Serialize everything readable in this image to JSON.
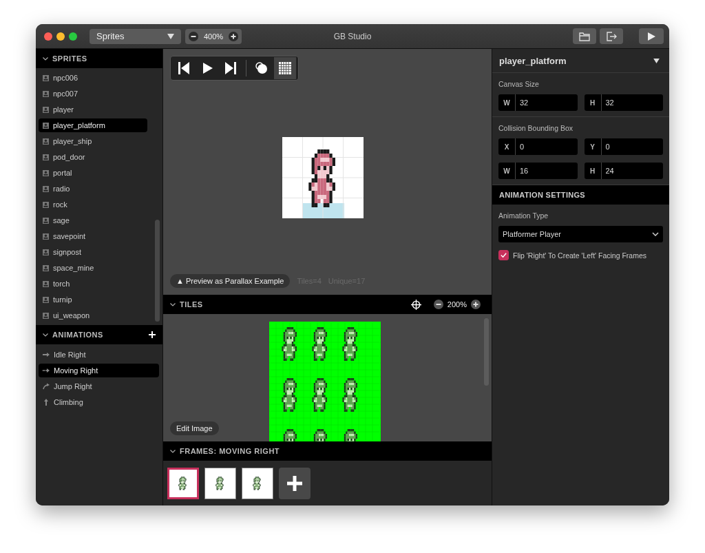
{
  "window": {
    "title": "GB Studio"
  },
  "toolbar": {
    "section_select": "Sprites",
    "zoom": "400%"
  },
  "sidebar": {
    "sprites_header": "SPRITES",
    "sprites": [
      {
        "label": "npc006",
        "selected": false
      },
      {
        "label": "npc007",
        "selected": false
      },
      {
        "label": "player",
        "selected": false
      },
      {
        "label": "player_platform",
        "selected": true
      },
      {
        "label": "player_ship",
        "selected": false
      },
      {
        "label": "pod_door",
        "selected": false
      },
      {
        "label": "portal",
        "selected": false
      },
      {
        "label": "radio",
        "selected": false
      },
      {
        "label": "rock",
        "selected": false
      },
      {
        "label": "sage",
        "selected": false
      },
      {
        "label": "savepoint",
        "selected": false
      },
      {
        "label": "signpost",
        "selected": false
      },
      {
        "label": "space_mine",
        "selected": false
      },
      {
        "label": "torch",
        "selected": false
      },
      {
        "label": "turnip",
        "selected": false
      },
      {
        "label": "ui_weapon",
        "selected": false
      }
    ],
    "animations_header": "ANIMATIONS",
    "animations": [
      {
        "label": "Idle Right",
        "kind": "idle",
        "selected": false
      },
      {
        "label": "Moving Right",
        "kind": "move",
        "selected": true
      },
      {
        "label": "Jump Right",
        "kind": "jump",
        "selected": false
      },
      {
        "label": "Climbing",
        "kind": "climb",
        "selected": false
      }
    ]
  },
  "preview": {
    "controls": [
      {
        "kind": "first",
        "selected": false
      },
      {
        "kind": "play",
        "selected": false
      },
      {
        "kind": "last",
        "selected": false
      },
      {
        "kind": "onion",
        "selected": false
      },
      {
        "kind": "grid",
        "selected": true
      }
    ],
    "parallax_button": "▲ Preview as Parallax Example",
    "tiles_count": "Tiles=4",
    "unique_count": "Unique=17"
  },
  "tiles": {
    "header": "TILES",
    "zoom": "200%",
    "edit_button": "Edit Image"
  },
  "frames": {
    "header": "FRAMES: MOVING RIGHT",
    "items": [
      {
        "selected": true
      },
      {
        "selected": false
      },
      {
        "selected": false
      }
    ]
  },
  "inspector": {
    "title": "player_platform",
    "canvas_size": {
      "label": "Canvas Size",
      "fields": [
        {
          "prefix": "W",
          "value": "32"
        },
        {
          "prefix": "H",
          "value": "32"
        }
      ]
    },
    "collision": {
      "label": "Collision Bounding Box",
      "fields": [
        {
          "prefix": "X",
          "value": "0"
        },
        {
          "prefix": "Y",
          "value": "0"
        },
        {
          "prefix": "W",
          "value": "16"
        },
        {
          "prefix": "H",
          "value": "24"
        }
      ]
    },
    "animation_settings": {
      "header": "ANIMATION SETTINGS",
      "type_label": "Animation Type",
      "type_value": "Platformer Player",
      "flip": {
        "label": "Flip 'Right' To Create 'Left' Facing Frames",
        "checked": true
      }
    }
  }
}
